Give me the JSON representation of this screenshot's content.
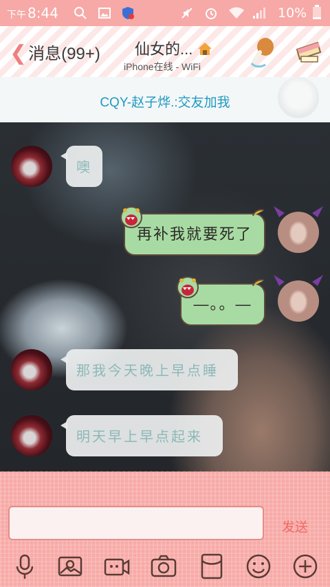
{
  "status_bar": {
    "am_pm": "下午",
    "time": "8:44",
    "battery_percent": "10%",
    "icons": [
      "search-icon",
      "image-icon",
      "shield-icon",
      "mute-icon",
      "alarm-icon",
      "wifi-icon",
      "signal-icon",
      "battery-icon"
    ]
  },
  "header": {
    "back_label": "消息(99+)",
    "title": "仙女的...",
    "title_icon": "house-icon",
    "subtitle": "iPhone在线 - WiFi",
    "right_icons": [
      "drumstick-icon",
      "card-icon"
    ]
  },
  "banner": {
    "text": "CQY-赵子烨.:交友加我"
  },
  "messages": [
    {
      "side": "left",
      "text": "噢"
    },
    {
      "side": "right",
      "text": "再补我就要死了"
    },
    {
      "side": "right",
      "text": "—。。—"
    },
    {
      "side": "left",
      "text": "那我今天晚上早点睡"
    },
    {
      "side": "left",
      "text": "明天早上早点起来"
    }
  ],
  "input": {
    "value": "",
    "placeholder": "",
    "send_label": "发送"
  },
  "toolbar": [
    "microphone-icon",
    "photo-icon",
    "video-icon",
    "camera-icon",
    "red-packet-icon",
    "emoji-icon",
    "plus-icon"
  ],
  "colors": {
    "status_bar": "#f6a9a6",
    "accent": "#1f9ac0",
    "right_bubble": "#a8dba3",
    "bottom_panel": "#f7aaa7",
    "send_text": "#ee6a66"
  }
}
